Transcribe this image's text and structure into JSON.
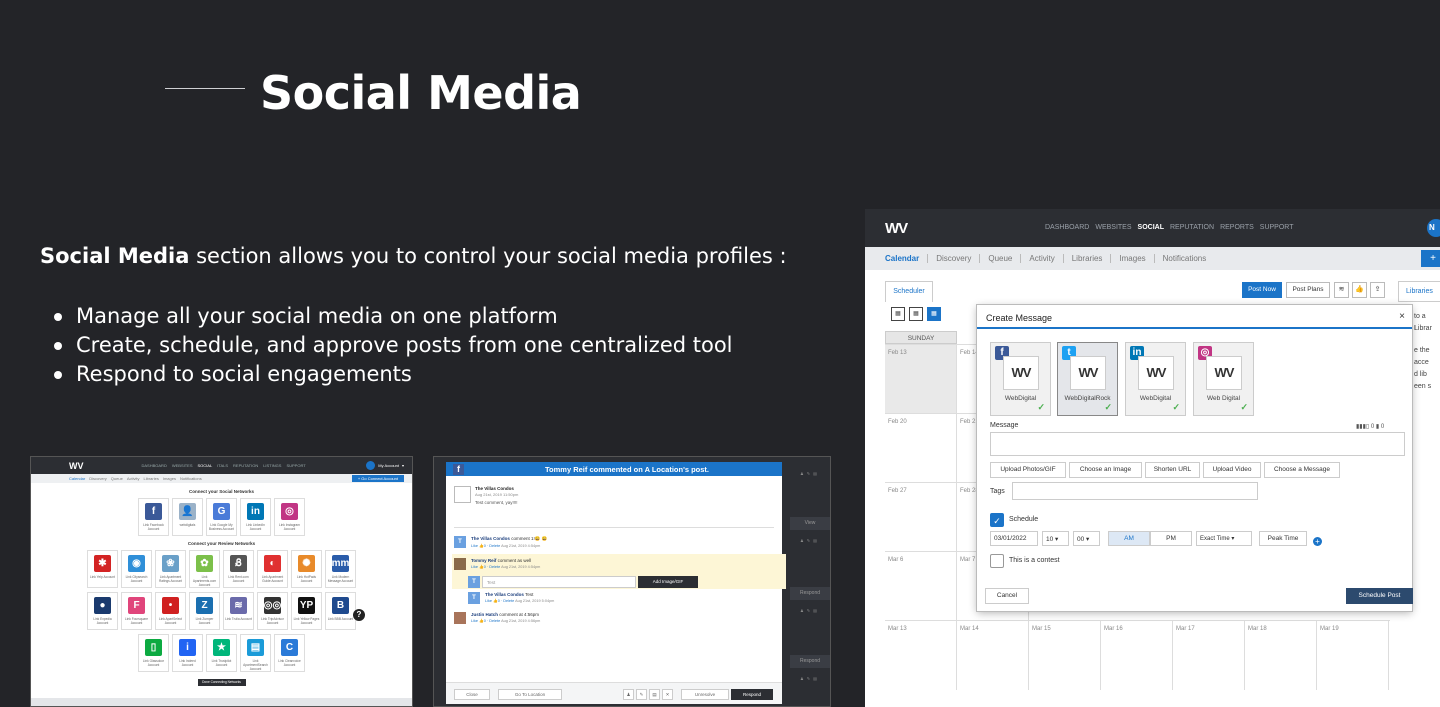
{
  "heading": {
    "title": "Social Media"
  },
  "intro": {
    "bold": "Social Media",
    "rest": " section allows you to control your social media profiles :"
  },
  "bullets": [
    "Manage all your social media on one platform",
    "Create, schedule, and approve posts from one centralized tool",
    "Respond to social engagements"
  ],
  "shot1": {
    "nav": [
      "DASHBOARD",
      "WEBSITES",
      "SOCIAL",
      "ITALS",
      "REPUTATION",
      "LISTINGS",
      "SUPPORT"
    ],
    "account": "My Account",
    "tabs": [
      "Calendar",
      "Discovery",
      "Queue",
      "Activity",
      "Libraries",
      "Images",
      "Notifications"
    ],
    "connect_button": "+ Go Connect Account",
    "social_title": "Connect your Social Networks",
    "social_tiles": [
      {
        "label": "Link Facebook Account",
        "glyph": "f",
        "color": "#3b5998"
      },
      {
        "label": "webdigitals",
        "glyph": "👤",
        "color": "#9bb2c8"
      },
      {
        "label": "Link Google My Business Account",
        "glyph": "G",
        "color": "#4a7bd8"
      },
      {
        "label": "Link LinkedIn Account",
        "glyph": "in",
        "color": "#0077b5"
      },
      {
        "label": "Link Instagram Account",
        "glyph": "◎",
        "color": "#c13584"
      }
    ],
    "review_title": "Connect your Review Networks",
    "review_tiles": [
      {
        "label": "Link Yelp Account",
        "glyph": "✱",
        "color": "#d32323"
      },
      {
        "label": "Link Citysearch Account",
        "glyph": "◉",
        "color": "#2f8fd8"
      },
      {
        "label": "Link Apartment Ratings Account",
        "glyph": "❀",
        "color": "#6aa0c8"
      },
      {
        "label": "Link Apartments.com Account",
        "glyph": "✿",
        "color": "#7cc04a"
      },
      {
        "label": "Link Rent.com Account",
        "glyph": "Ᏸ",
        "color": "#555555"
      },
      {
        "label": "Link Apartment Guide Account",
        "glyph": "◐",
        "color": "#e03030"
      },
      {
        "label": "Link HotPads Account",
        "glyph": "✺",
        "color": "#e88a2a"
      },
      {
        "label": "Link Modern Message Account",
        "glyph": "mm",
        "color": "#2a5caa"
      },
      {
        "label": "Link Expedia Account",
        "glyph": "●",
        "color": "#1a3a6e"
      },
      {
        "label": "Link Foursquare Account",
        "glyph": "F",
        "color": "#e0457b"
      },
      {
        "label": "Link ApartSelect Account",
        "glyph": "•",
        "color": "#d02020"
      },
      {
        "label": "Link Zumper Account",
        "glyph": "Z",
        "color": "#1b6fb0"
      },
      {
        "label": "Link Trulia Account",
        "glyph": "≋",
        "color": "#6a6aaa"
      },
      {
        "label": "Link TripAdvisor Account",
        "glyph": "◎◎",
        "color": "#333333"
      },
      {
        "label": "Link Yellow Pages Account",
        "glyph": "YP",
        "color": "#111111"
      },
      {
        "label": "Link BBB Account",
        "glyph": "B",
        "color": "#1f4a8e"
      }
    ],
    "last_tiles": [
      {
        "label": "Link Glassdoor Account",
        "glyph": "▯",
        "color": "#0caa41"
      },
      {
        "label": "Link Indeed Account",
        "glyph": "i",
        "color": "#2164f3"
      },
      {
        "label": "Link Trustpilot Account",
        "glyph": "★",
        "color": "#00b67a"
      },
      {
        "label": "Link ApartmentSearch Account",
        "glyph": "▤",
        "color": "#1b9bd8"
      },
      {
        "label": "Link Cleanvoice Account",
        "glyph": "C",
        "color": "#2a7ad8"
      }
    ],
    "dark_button": "Done Connecting Networks",
    "help": "?"
  },
  "shot2": {
    "header": "Tommy Reif commented on A Location's post.",
    "post_author": "The Villas Condos",
    "post_date": "Aug 21st, 2019 11:50pm",
    "post_text": "Test comment, yay!!!!",
    "comments": [
      {
        "initial": "T",
        "color": "#6aa0e0",
        "name": "The Villas Condos",
        "text": " comment 1!😄 😄",
        "meta": "Like 👍0 · Delete",
        "date": "Aug 21st, 2019 4:54pm"
      },
      {
        "initial": "",
        "color": "#8a6a4a",
        "name": "Tommy Reif",
        "text": " comment as well",
        "meta": "Like 👍0 · Delete",
        "date": "Aug 21st, 2019 4:54pm"
      },
      {
        "initial": "T",
        "color": "#6aa0e0",
        "name": "The Villas Condos",
        "text": " Test",
        "meta": "Like 👍0 · Delete",
        "date": "Aug 21st, 2019 5:04pm"
      },
      {
        "initial": "",
        "color": "#a8745a",
        "name": "Justin Hatch",
        "text": " comment at 4:56pm",
        "meta": "Like 👍0 · Delete",
        "date": "Aug 21st, 2019 4:56pm"
      }
    ],
    "reply_placeholder": "Test",
    "reply_initial": "T",
    "add_image": "Add Image/GIF",
    "footer": {
      "close": "Close",
      "goto": "Go To Location",
      "unresolve": "Unresolve",
      "respond": "Respond"
    },
    "side": [
      "View",
      "Respond",
      "Respond"
    ]
  },
  "shot3": {
    "nav": [
      "DASHBOARD",
      "WEBSITES",
      "SOCIAL",
      "REPUTATION",
      "REPORTS",
      "SUPPORT"
    ],
    "tabs": [
      "Calendar",
      "Discovery",
      "Queue",
      "Activity",
      "Libraries",
      "Images",
      "Notifications"
    ],
    "user_initial": "N",
    "plus": "+",
    "scheduler_tab": "Scheduler",
    "post_now": "Post Now",
    "post_plans": "Post Plans",
    "libraries_tab": "Libraries",
    "day_head": "SUNDAY",
    "weeks": [
      [
        "Feb 13",
        "Feb 14"
      ],
      [
        "Feb 20",
        "Feb 21"
      ],
      [
        "Feb 27",
        "Feb 28"
      ],
      [
        "Mar 6",
        "Mar 7"
      ],
      [
        "Mar 13",
        "Mar 14",
        "Mar 15",
        "Mar 16",
        "Mar 17",
        "Mar 18",
        "Mar 19"
      ]
    ],
    "right_text": [
      "to a L",
      "Librar",
      "e the",
      "acce",
      "d lib",
      "een s"
    ],
    "modal": {
      "title": "Create Message",
      "close": "×",
      "accounts": [
        {
          "net": "f",
          "color": "#3b5998",
          "name": "WebDigital"
        },
        {
          "net": "t",
          "color": "#1da1f2",
          "name": "WebDigitalRock"
        },
        {
          "net": "in",
          "color": "#0077b5",
          "name": "WebDigital"
        },
        {
          "net": "◎",
          "color": "#c13584",
          "name": "Web Digital"
        }
      ],
      "message_label": "Message",
      "counts": "▮▮▮▯ 0   ▮ 0",
      "buttons": [
        "Upload Photos/GIF",
        "Choose an Image",
        "Shorten URL",
        "Upload Video",
        "Choose a Message"
      ],
      "tags_label": "Tags",
      "schedule_label": "Schedule",
      "date": "03/01/2022",
      "hour": "10",
      "minute": "00",
      "am": "AM",
      "pm": "PM",
      "exact": "Exact Time",
      "peak": "Peak Time",
      "contest": "This is a contest",
      "cancel": "Cancel",
      "schedule_post": "Schedule Post"
    }
  }
}
